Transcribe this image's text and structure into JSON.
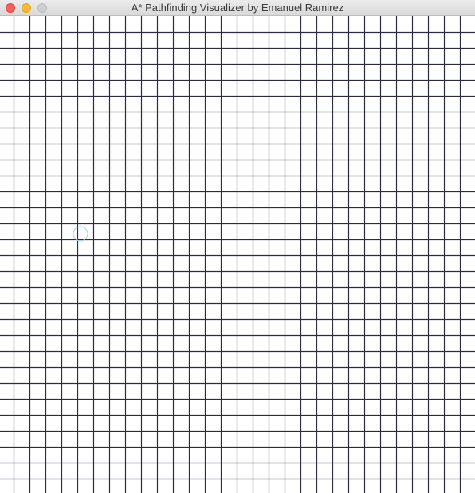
{
  "window": {
    "title": "A* Pathfinding Visualizer by Emanuel Ramirez",
    "controls": {
      "close_icon": "close-icon",
      "minimize_icon": "minimize-icon",
      "zoom_icon": "zoom-icon"
    }
  },
  "grid": {
    "rows": 30,
    "cols": 30,
    "line_color": "#2b2b45",
    "background_color": "#ffffff"
  },
  "cursor": {
    "icon": "cursor-ring-icon",
    "color": "#9fd3ee",
    "row": 13,
    "col": 5
  }
}
